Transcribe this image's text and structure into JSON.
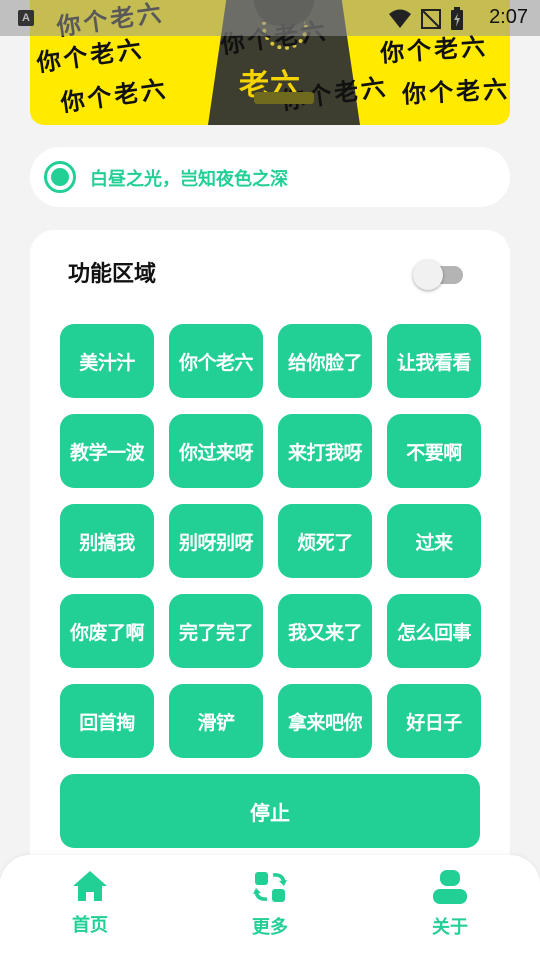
{
  "status_bar": {
    "time": "2:07",
    "notification_icon": "A"
  },
  "banner": {
    "scribble_text": "你个老六",
    "shirt_text": "老六"
  },
  "radio": {
    "label": "白昼之光，岂知夜色之深",
    "selected": true
  },
  "function_area": {
    "title": "功能区域",
    "toggle_on": false,
    "buttons": [
      "美汁汁",
      "你个老六",
      "给你脸了",
      "让我看看",
      "教学一波",
      "你过来呀",
      "来打我呀",
      "不要啊",
      "别搞我",
      "别呀别呀",
      "烦死了",
      "过来",
      "你废了啊",
      "完了完了",
      "我又来了",
      "怎么回事",
      "回首掏",
      "滑铲",
      "拿来吧你",
      "好日子"
    ],
    "stop_label": "停止"
  },
  "bottom_nav": {
    "items": [
      {
        "label": "首页",
        "icon": "home-icon"
      },
      {
        "label": "更多",
        "icon": "switch-icon"
      },
      {
        "label": "关于",
        "icon": "person-icon"
      }
    ]
  },
  "colors": {
    "accent": "#22cf95",
    "banner": "#ffea00",
    "background": "#f2f3f2"
  }
}
